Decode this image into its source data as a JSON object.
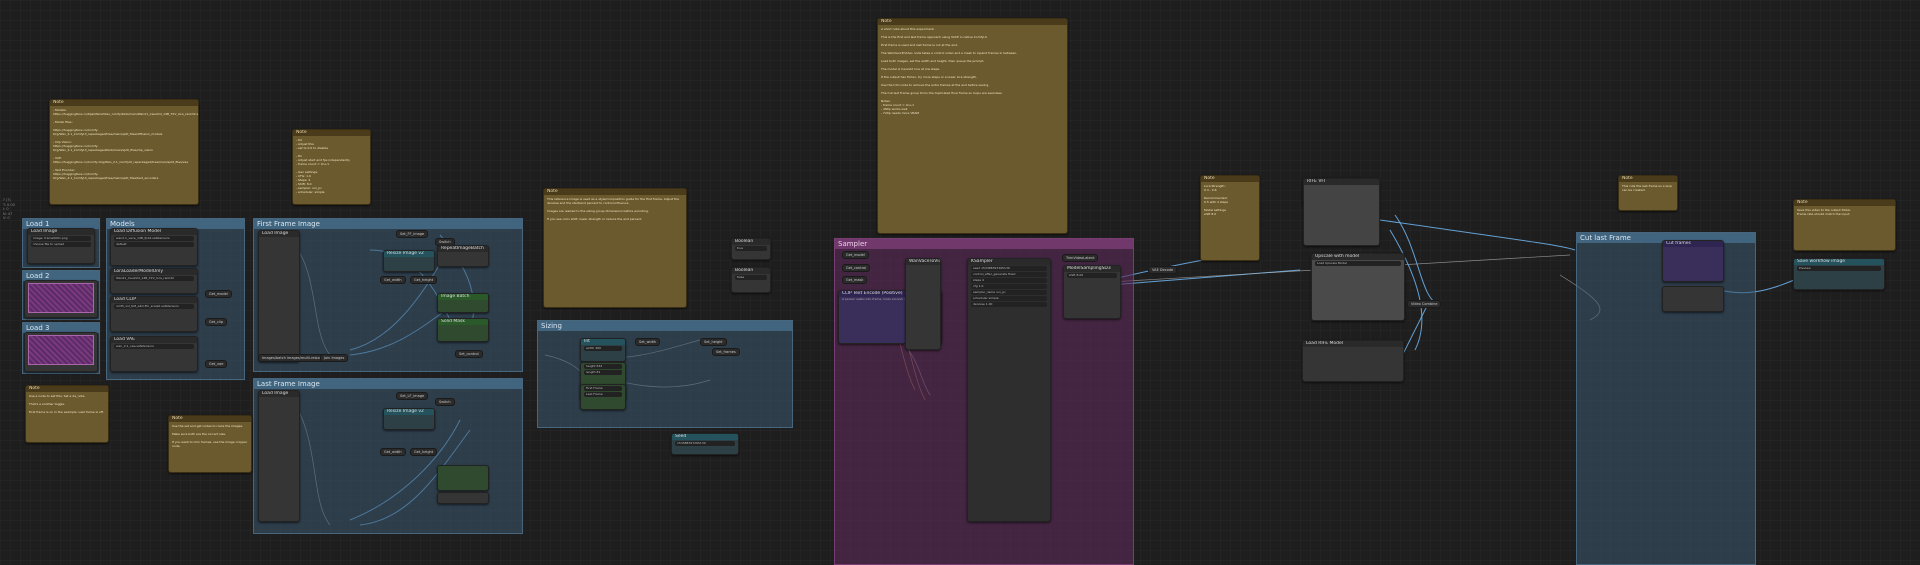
{
  "canvas_info": [
    "? (?)",
    "T: 0.00",
    "I: 0",
    "N: 47",
    "V: 0"
  ],
  "groups": {
    "load1": "Load 1",
    "models": "Models",
    "load2": "Load 2",
    "load3": "Load 3",
    "first_frame": "First Frame Image",
    "last_frame": "Last Frame Image",
    "sizing": "Sizing",
    "sampler": "Sampler",
    "cut_last": "Cut last Frame"
  },
  "notes": {
    "title": "Note",
    "note_a": "- Models:\nhttps://huggingface.co/Kijai/WanVideo_comfy/blob/main/Wan21_CausVid_14B_T2V_lora_rank32.safetensors\n\n- Model Files:\n\nhttps://huggingface.co/Comfy-Org/Wan_2.1_ComfyUI_repackaged/tree/main/split_files/diffusion_models\n\n- Clip Vision:\nhttps://huggingface.co/Comfy-Org/Wan_2.1_ComfyUI_repackaged/blob/main/split_files/clip_vision\n\n- VAE:\nhttps://huggingface.co/Comfy-Org/Wan_2.1_ComfyUI_repackaged/tree/main/split_files/vae\n\n- Text Encoder:\nhttps://huggingface.co/Comfy-Org/Wan_2.1_ComfyUI_repackaged/tree/main/split_files/text_encoders",
    "note_b": "- 64\n- Adjust this\n- set to 0.0 to disable\n\n- 81\n- Adjust start and fps independently\n- frame count = 4n+1\n\n- Gen settings:\n- CFG: 1.0\n- Steps: 4\n- Shift: 8.0\n- sampler: uni_pc\n- scheduler: simple",
    "note_c": "Use a node to set this. Set a da_note.\n\nThat's a another toggle.\n\nFirst frame is on in the example. Last frame is off.",
    "note_d": "Use the set and get nodes to route the images.\n\nMake sure both are the correct size.\n\nIf you want to trim frames, use the image cropper node.",
    "note_e": "This reference image is used as a style/composition guide for the first frame. Adjust the denoise and the start/end percent to control influence.\n\nImages are resized to the sizing group dimensions before encoding.\n\nIf you see color shift, lower strength or reduce the end percent.",
    "note_f": "A short note about this experiment.\n\nThis is the first and last frame approach using VACE in native ComfyUI.\n\nFirst frame is used and last frame is cut at the end.\n\nThe WanVaceToVideo node takes a control video and a mask to inpaint frames in between.\n\nLoad both images, set the width and height, then queue the prompt.\n\nThe model is CausVid lora at low steps.\n\nIf the output has flicker, try more steps or a lower lora strength.\n\nUse the trim node to remove the extra frames at the end before saving.\n\nThe Cut last Frame group trims the duplicated final frame so loops are seamless.\n\nNotes:\n- frame count = 4n+1\n- 480p works well\n- 720p needs more VRAM",
    "note_g": "Lora Strength:\n0.3 - 0.6\n\nRecommended:\n0.5 with 4 steps\n\nModel settings\nshift 8.0",
    "note_h": "This cuts the last frame so a loop can be created.",
    "note_i": "Save this video to the output folder.\nFrame rate should match the input."
  },
  "load1": {
    "title": "Load Image",
    "file_label": "image",
    "file_value": "frame0001.png",
    "upload": "choose file to upload"
  },
  "models": {
    "unet_title": "Load Diffusion Model",
    "unet_name": "wan2.1_vace_14B_fp16.safetensors",
    "weight": "default",
    "lora_title": "LoraLoaderModelOnly",
    "lora_name": "Wan21_CausVid_14B_T2V_lora_rank32",
    "lora_strength": "0.50",
    "clip_title": "Load CLIP",
    "clip_name": "umt5_xxl_fp8_e4m3fn_scaled.safetensors",
    "vae_title": "Load VAE",
    "vae_name": "wan_2.1_vae.safetensors",
    "get_model": "Get_model",
    "get_clip": "Get_clip",
    "get_vae": "Get_vae"
  },
  "first_frame": {
    "load_label": "Load Image",
    "resize": "Resize Image v2",
    "width": "width",
    "height": "height",
    "set_ff": "Set_FF_image",
    "switch": "Switch",
    "get_width": "Get_width",
    "get_height": "Get_height",
    "repeat": "RepeatImageBatch",
    "mask": "Solid Mask",
    "image_batch": "Image Batch",
    "set_control": "Set_control",
    "set_mask": "Set_mask",
    "bottom_left": "Images/batch images/multi-resize",
    "bottom_mid": "Join Images",
    "bottom_right": "Set mask composite"
  },
  "last_frame": {
    "load_label": "Load Image",
    "resize": "Resize Image v2",
    "set_lf": "Set_LF_image",
    "switch": "Switch",
    "get_width": "Get_width",
    "get_height": "Get_height"
  },
  "sizing": {
    "int_node": "Int",
    "width_label": "width",
    "width_value": "480",
    "height_label": "height",
    "height_value": "832",
    "frames_label": "length",
    "frames_value": "81",
    "set_width": "Set_width",
    "set_height": "Set_height",
    "set_frames": "Set_frames",
    "first_frame_toggle": "First Frame",
    "last_frame_toggle": "Last Frame"
  },
  "mid_boxes": {
    "a_title": "Boolean",
    "a_value": "true",
    "b_title": "Boolean",
    "b_value": "false",
    "c_title": "Seed",
    "c_value": "153488397265130"
  },
  "sampler": {
    "get_model": "Get_model",
    "get_control": "Get_control",
    "get_mask": "Get_mask",
    "positive": "CLIP Text Encode (Positive)",
    "positive_text": "A person walks into frame, looks around, and waves.",
    "vace_title": "WanVaceToVideo",
    "ksampler_title": "KSampler",
    "ks_seed": "seed",
    "ks_seed_v": "153488397265130",
    "ks_control": "control_after_generate",
    "ks_control_v": "fixed",
    "ks_steps": "steps",
    "ks_steps_v": "4",
    "ks_cfg": "cfg",
    "ks_cfg_v": "1.0",
    "ks_sampler": "sampler_name",
    "ks_sampler_v": "uni_pc",
    "ks_sched": "scheduler",
    "ks_sched_v": "simple",
    "ks_denoise": "denoise",
    "ks_denoise_v": "1.00",
    "model_sampling": "ModelSamplingSD3",
    "shift": "shift",
    "shift_v": "8.00",
    "trim": "TrimVideoLatent",
    "vae_decode": "VAE Decode"
  },
  "right": {
    "vace_node": "VACEnodes",
    "upscale": "Upscale with model",
    "upscale_model": "Load Upscale Model",
    "video_combine": "Video Combine",
    "rife": "RIFE VFI",
    "load_rife": "Load RIFE Model",
    "cut_frames": "Cut frames",
    "save_title": "Save workflow image",
    "preview": "Preview"
  }
}
